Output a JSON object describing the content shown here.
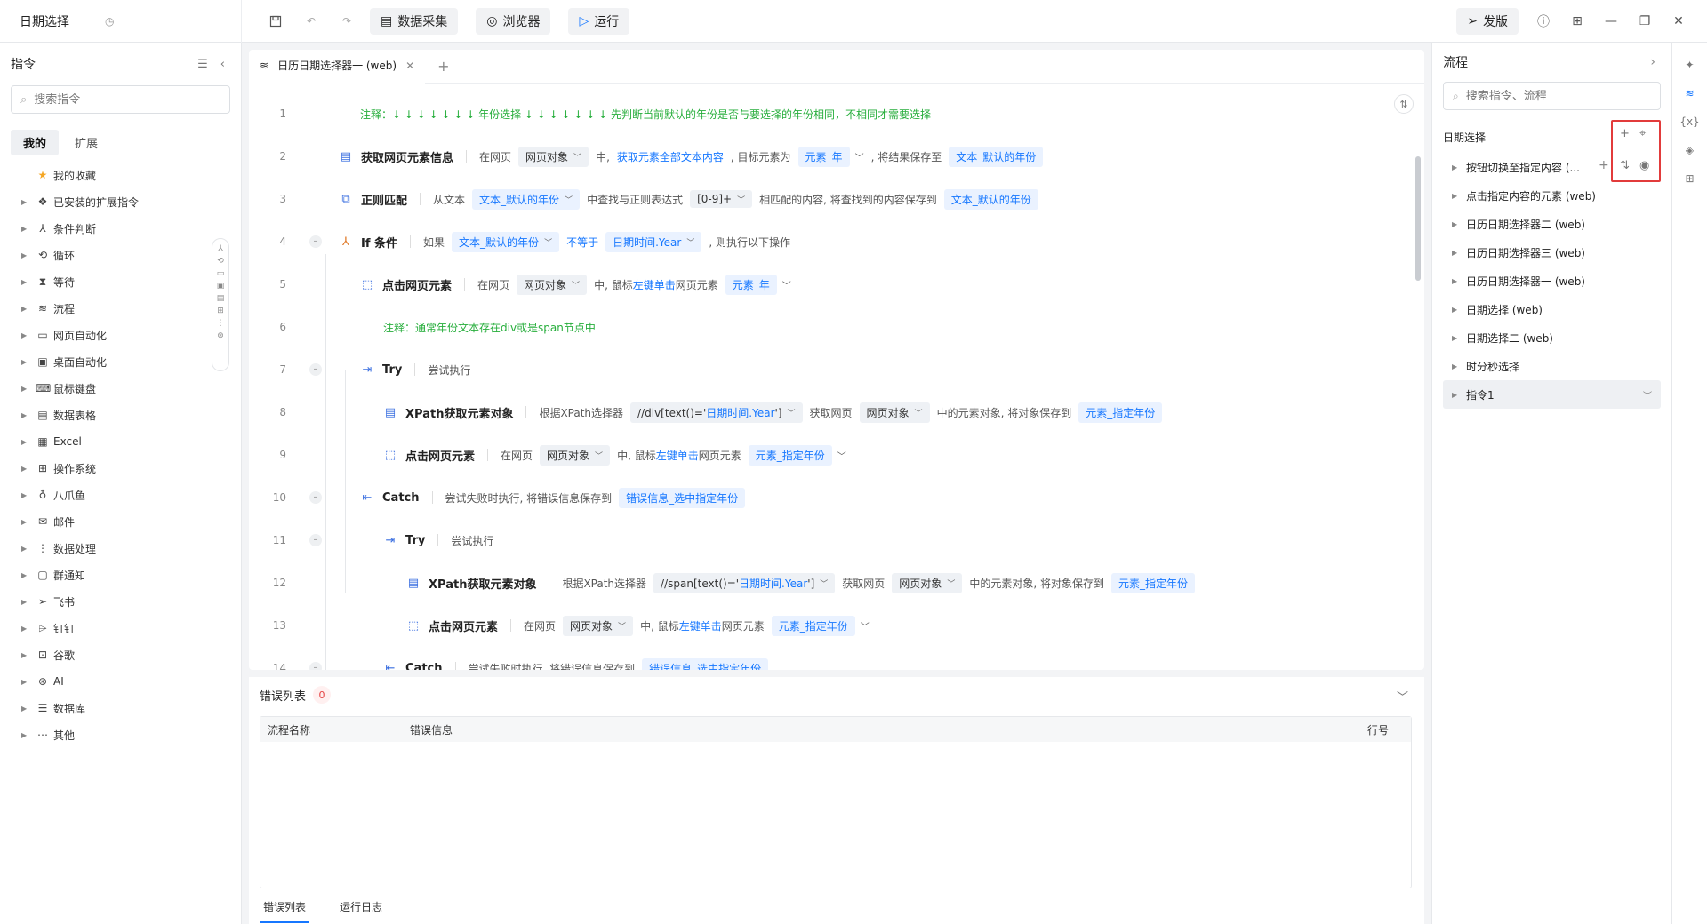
{
  "app": {
    "title": "日期选择"
  },
  "toolbar": {
    "data_collect": "数据采集",
    "browser": "浏览器",
    "run": "运行",
    "publish": "发版"
  },
  "left": {
    "title": "指令",
    "search_placeholder": "搜索指令",
    "tabs": [
      "我的",
      "扩展"
    ],
    "items": [
      "我的收藏",
      "已安装的扩展指令",
      "条件判断",
      "循环",
      "等待",
      "流程",
      "网页自动化",
      "桌面自动化",
      "鼠标键盘",
      "数据表格",
      "Excel",
      "操作系统",
      "八爪鱼",
      "邮件",
      "数据处理",
      "群通知",
      "飞书",
      "钉钉",
      "谷歌",
      "AI",
      "数据库",
      "其他"
    ]
  },
  "editor": {
    "tab_title": "日历日期选择器一 (web)",
    "lines": {
      "n1": "1",
      "n2": "2",
      "n3": "3",
      "n4": "4",
      "n5": "5",
      "n6": "6",
      "n7": "7",
      "n8": "8",
      "n9": "9",
      "n10": "10",
      "n11": "11",
      "n12": "12",
      "n13": "13",
      "n14": "14"
    },
    "l1": {
      "note": "注释：↓ ↓ ↓ ↓ ↓ ↓ ↓  年份选择  ↓ ↓ ↓ ↓ ↓ ↓ ↓  先判断当前默认的年份是否与要选择的年份相同，不相同才需要选择"
    },
    "l2": {
      "title": "获取网页元素信息",
      "t1": "在网页",
      "p1": "网页对象",
      "t2": "中,",
      "h1": "获取元素全部文本内容",
      "t3": ", 目标元素为",
      "p2": "元素_年",
      "t4": ", 将结果保存至",
      "p3": "文本_默认的年份"
    },
    "l3": {
      "title": "正则匹配",
      "t1": "从文本",
      "p1": "文本_默认的年份",
      "t2": "中查找与正则表达式",
      "p2": "[0-9]+",
      "t3": "相匹配的内容, 将查找到的内容保存到",
      "p3": "文本_默认的年份"
    },
    "l4": {
      "title": "If 条件",
      "t1": "如果",
      "p1": "文本_默认的年份",
      "h1": "不等于",
      "p2": "日期时间.Year",
      "t2": ", 则执行以下操作"
    },
    "l5": {
      "title": "点击网页元素",
      "t1": "在网页",
      "p1": "网页对象",
      "t2": "中, 鼠标",
      "h1": "左键单击",
      "t3": "网页元素",
      "p2": "元素_年"
    },
    "l6": {
      "note": "注释：通常年份文本存在div或是span节点中"
    },
    "l7": {
      "title": "Try",
      "t1": "尝试执行"
    },
    "l8": {
      "title": "XPath获取元素对象",
      "t1": "根据XPath选择器",
      "p1a": "//div[text()='",
      "p1b": "日期时间.Year",
      "p1c": "']",
      "t2": "获取网页",
      "p2": "网页对象",
      "t3": "中的元素对象, 将对象保存到",
      "p3": "元素_指定年份"
    },
    "l9": {
      "title": "点击网页元素",
      "t1": "在网页",
      "p1": "网页对象",
      "t2": "中, 鼠标",
      "h1": "左键单击",
      "t3": "网页元素",
      "p2": "元素_指定年份"
    },
    "l10": {
      "title": "Catch",
      "t1": "尝试失败时执行, 将错误信息保存到",
      "p1": "错误信息_选中指定年份"
    },
    "l11": {
      "title": "Try",
      "t1": "尝试执行"
    },
    "l12": {
      "title": "XPath获取元素对象",
      "t1": "根据XPath选择器",
      "p1a": "//span[text()='",
      "p1b": "日期时间.Year",
      "p1c": "']",
      "t2": "获取网页",
      "p2": "网页对象",
      "t3": "中的元素对象, 将对象保存到",
      "p3": "元素_指定年份"
    },
    "l13": {
      "title": "点击网页元素",
      "t1": "在网页",
      "p1": "网页对象",
      "t2": "中, 鼠标",
      "h1": "左键单击",
      "t3": "网页元素",
      "p2": "元素_指定年份"
    },
    "l14": {
      "title": "Catch",
      "t1": "尝试失败时执行, 将错误信息保存到",
      "p1": "错误信息_选中指定年份"
    }
  },
  "errors": {
    "title": "错误列表",
    "count": "0",
    "columns": [
      "流程名称",
      "错误信息",
      "行号"
    ],
    "tabs": [
      "错误列表",
      "运行日志"
    ]
  },
  "right": {
    "title": "流程",
    "search_placeholder": "搜索指令、流程",
    "group": "日期选择",
    "flows": [
      "按钮切换至指定内容 (...",
      "点击指定内容的元素 (web)",
      "日历日期选择器二 (web)",
      "日历日期选择器三 (web)",
      "日历日期选择器一 (web)",
      "日期选择 (web)",
      "日期选择二 (web)",
      "时分秒选择",
      "指令1"
    ]
  },
  "colors": {
    "accent": "#1677ff",
    "note": "#27ae3c",
    "highlight_box": "#e23b3b"
  }
}
